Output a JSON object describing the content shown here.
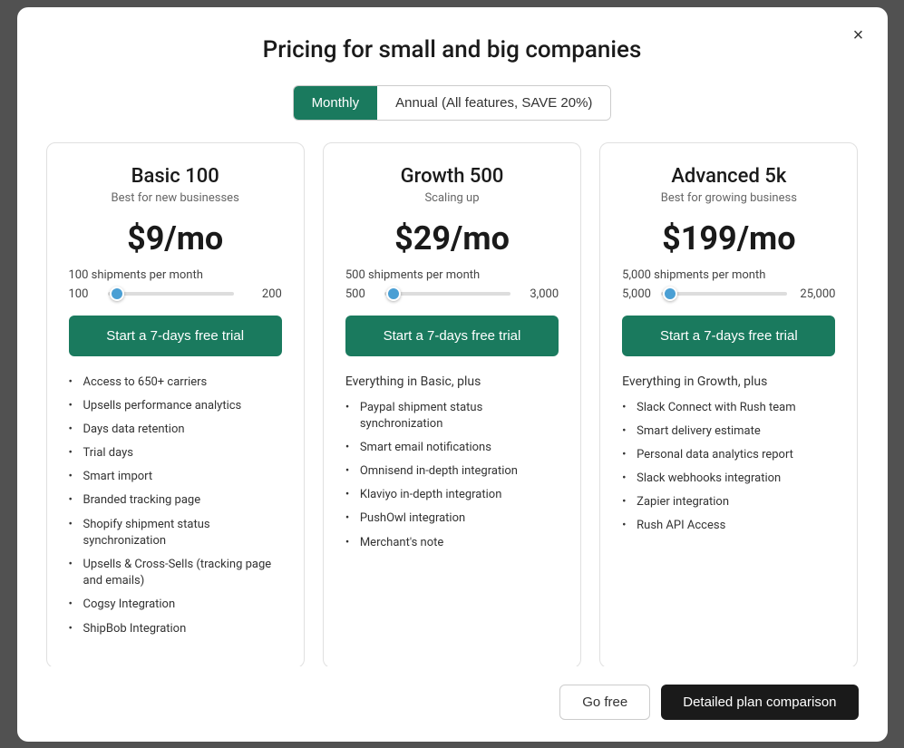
{
  "modal": {
    "title": "Pricing for small and big companies",
    "close_label": "×"
  },
  "billing": {
    "monthly_label": "Monthly",
    "annual_label": "Annual (All features, SAVE 20%)",
    "active": "monthly"
  },
  "plans": [
    {
      "id": "basic",
      "name": "Basic 100",
      "tagline": "Best for new businesses",
      "price": "$9/mo",
      "shipments_text": "100 shipments per month",
      "slider_min": "100",
      "slider_max": "200",
      "slider_thumb_pct": 2,
      "trial_btn": "Start a 7-days free trial",
      "features_intro": null,
      "features": [
        "Access to 650+ carriers",
        "Upsells performance analytics",
        "Days data retention",
        "Trial days",
        "Smart import",
        "Branded tracking page",
        "Shopify shipment status synchronization",
        "Upsells & Cross-Sells (tracking page and emails)",
        "Cogsy Integration",
        "ShipBob Integration"
      ]
    },
    {
      "id": "growth",
      "name": "Growth 500",
      "tagline": "Scaling up",
      "price": "$29/mo",
      "shipments_text": "500 shipments per month",
      "slider_min": "500",
      "slider_max": "3,000",
      "slider_thumb_pct": 2,
      "trial_btn": "Start a 7-days free trial",
      "features_intro": "Everything in Basic, plus",
      "features": [
        "Paypal shipment status synchronization",
        "Smart email notifications",
        "Omnisend in-depth integration",
        "Klaviyo in-depth integration",
        "PushOwl integration",
        "Merchant's note"
      ]
    },
    {
      "id": "advanced",
      "name": "Advanced 5k",
      "tagline": "Best for growing business",
      "price": "$199/mo",
      "shipments_text": "5,000 shipments per month",
      "slider_min": "5,000",
      "slider_max": "25,000",
      "slider_thumb_pct": 2,
      "trial_btn": "Start a 7-days free trial",
      "features_intro": "Everything in Growth, plus",
      "features": [
        "Slack Connect with Rush team",
        "Smart delivery estimate",
        "Personal data analytics report",
        "Slack webhooks integration",
        "Zapier integration",
        "Rush API Access"
      ]
    }
  ],
  "footer": {
    "go_free": "Go free",
    "detailed_comparison": "Detailed plan comparison"
  }
}
